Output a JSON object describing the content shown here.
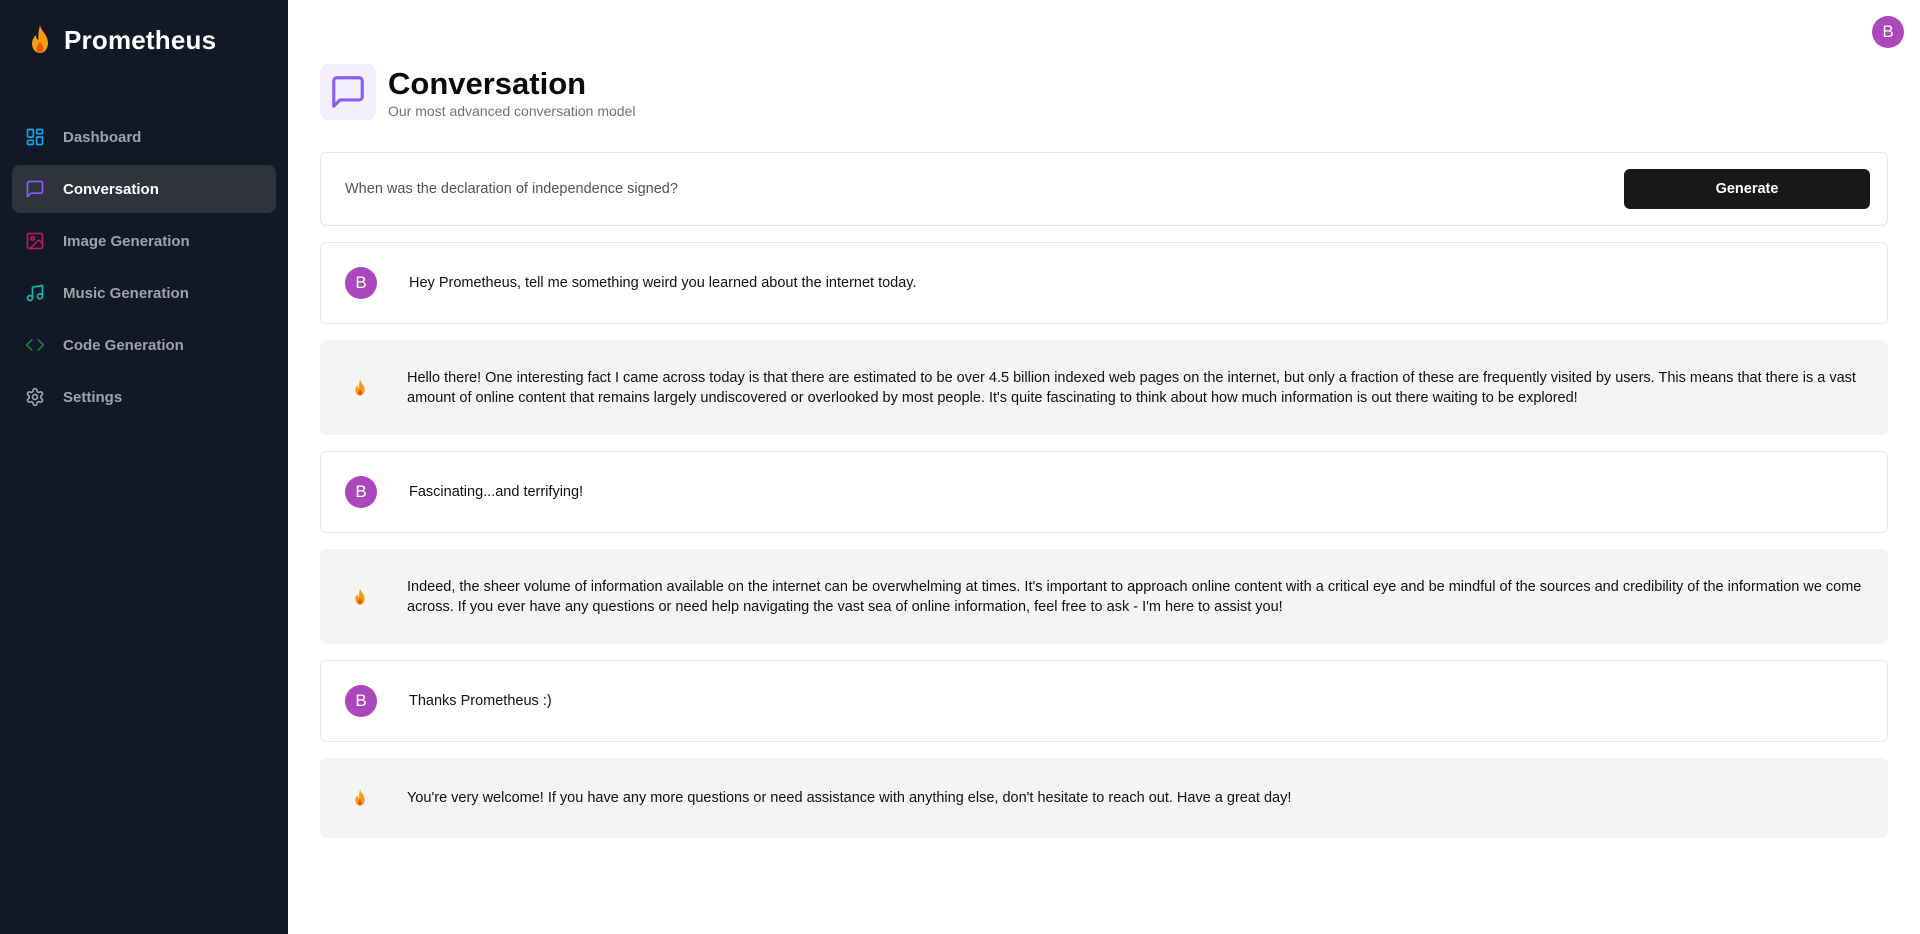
{
  "app": {
    "name": "Prometheus",
    "brand_color": "#f59e0b"
  },
  "sidebar": {
    "items": [
      {
        "label": "Dashboard",
        "icon": "dashboard-icon",
        "color": "#0ea5e9",
        "active": false
      },
      {
        "label": "Conversation",
        "icon": "message-square-icon",
        "color": "#8b5cf6",
        "active": true
      },
      {
        "label": "Image Generation",
        "icon": "image-icon",
        "color": "#be185d",
        "active": false
      },
      {
        "label": "Music Generation",
        "icon": "music-icon",
        "color": "#14b8a6",
        "active": false
      },
      {
        "label": "Code Generation",
        "icon": "code-icon",
        "color": "#15803d",
        "active": false
      },
      {
        "label": "Settings",
        "icon": "gear-icon",
        "color": "#a1a1aa",
        "active": false
      }
    ]
  },
  "user": {
    "initial": "B",
    "avatar_color": "#ab47bc"
  },
  "header": {
    "title": "Conversation",
    "subtitle": "Our most advanced conversation model",
    "icon": "message-square-icon",
    "icon_color": "#8b5cf6"
  },
  "prompt": {
    "placeholder": "When was the declaration of independence signed?",
    "value": "",
    "button_label": "Generate"
  },
  "messages": [
    {
      "role": "user",
      "avatar": "B",
      "text": "Hey Prometheus, tell me something weird you learned about the internet today."
    },
    {
      "role": "bot",
      "icon": "flame-icon",
      "text": "Hello there! One interesting fact I came across today is that there are estimated to be over 4.5 billion indexed web pages on the internet, but only a fraction of these are frequently visited by users. This means that there is a vast amount of online content that remains largely undiscovered or overlooked by most people. It's quite fascinating to think about how much information is out there waiting to be explored!"
    },
    {
      "role": "user",
      "avatar": "B",
      "text": "Fascinating...and terrifying!"
    },
    {
      "role": "bot",
      "icon": "flame-icon",
      "text": "Indeed, the sheer volume of information available on the internet can be overwhelming at times. It's important to approach online content with a critical eye and be mindful of the sources and credibility of the information we come across. If you ever have any questions or need help navigating the vast sea of online information, feel free to ask - I'm here to assist you!"
    },
    {
      "role": "user",
      "avatar": "B",
      "text": "Thanks Prometheus :)"
    },
    {
      "role": "bot",
      "icon": "flame-icon",
      "text": "You're very welcome! If you have any more questions or need assistance with anything else, don't hesitate to reach out. Have a great day!"
    }
  ]
}
